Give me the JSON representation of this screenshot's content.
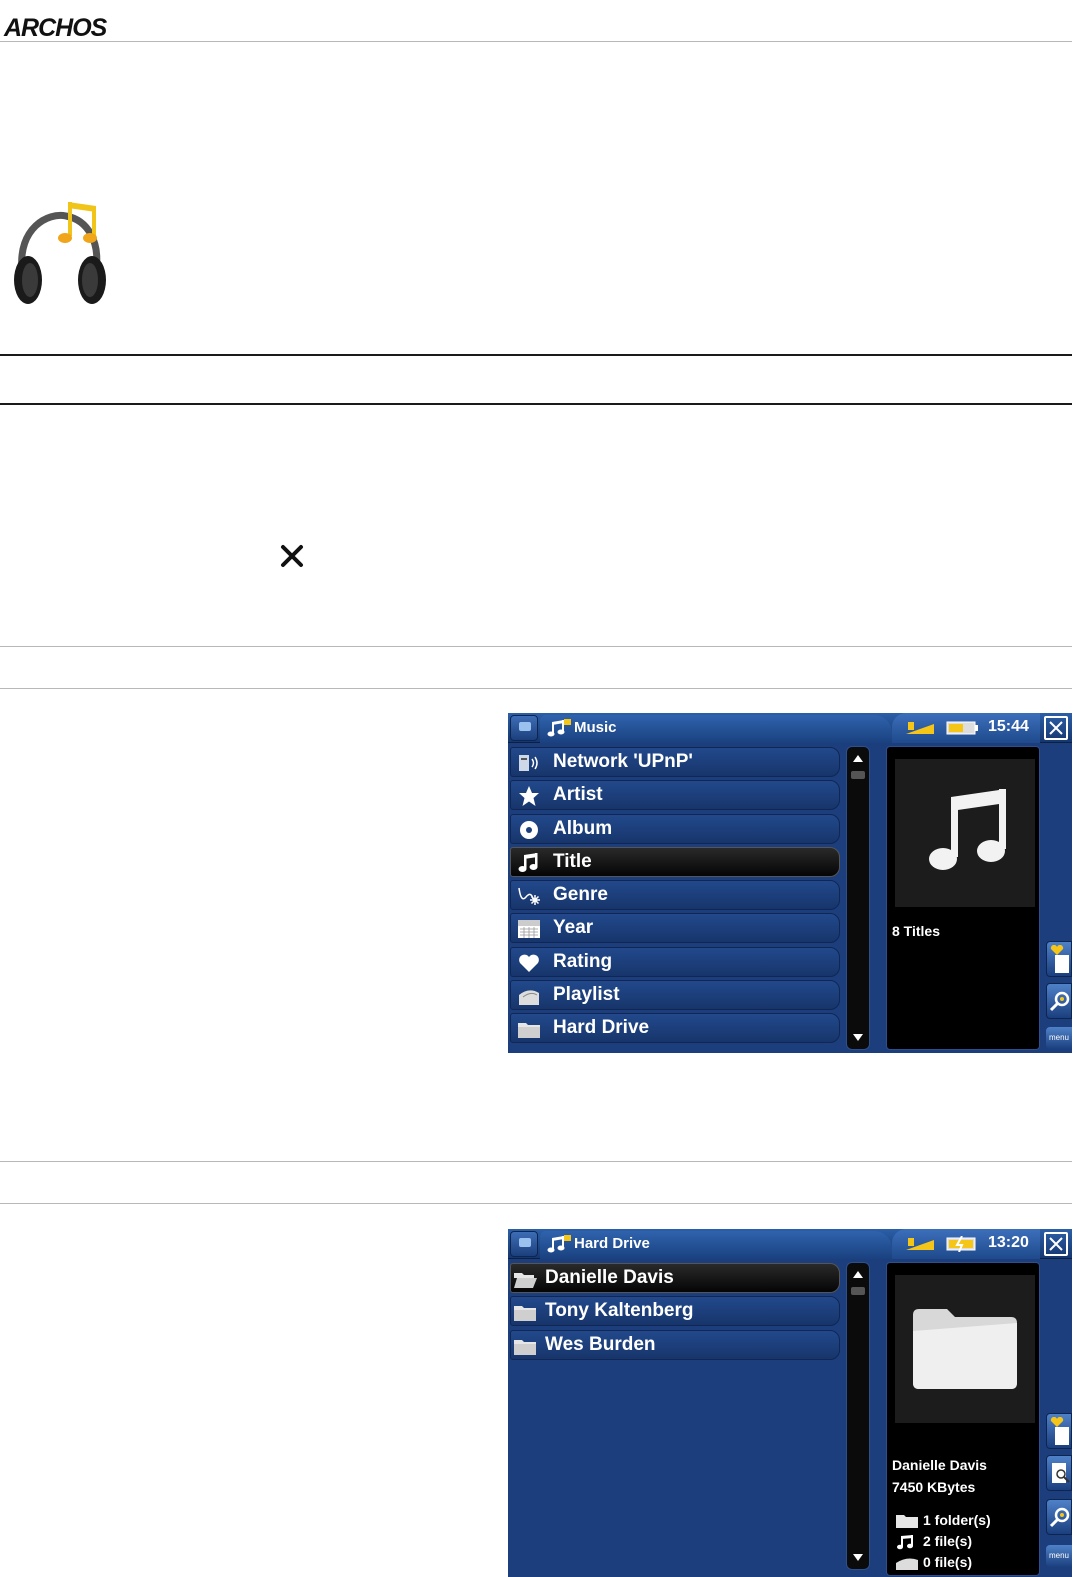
{
  "header": {
    "logo": "ARCHOS"
  },
  "screen1": {
    "title": "Music",
    "time": "15:44",
    "items": [
      {
        "label": "Network 'UPnP'",
        "icon": "network-icon"
      },
      {
        "label": "Artist",
        "icon": "star-icon"
      },
      {
        "label": "Album",
        "icon": "disc-icon"
      },
      {
        "label": "Title",
        "icon": "music-note-icon",
        "selected": true
      },
      {
        "label": "Genre",
        "icon": "genre-icon"
      },
      {
        "label": "Year",
        "icon": "calendar-icon"
      },
      {
        "label": "Rating",
        "icon": "heart-icon"
      },
      {
        "label": "Playlist",
        "icon": "playlist-icon"
      },
      {
        "label": "Hard Drive",
        "icon": "folder-icon"
      }
    ],
    "preview": {
      "caption": "8 Titles"
    },
    "menu_label": "menu"
  },
  "screen2": {
    "title": "Hard Drive",
    "time": "13:20",
    "items": [
      {
        "label": "Danielle Davis",
        "icon": "open-folder-icon",
        "selected": true
      },
      {
        "label": "Tony Kaltenberg",
        "icon": "folder-icon"
      },
      {
        "label": "Wes Burden",
        "icon": "folder-icon"
      }
    ],
    "preview": {
      "name": "Danielle Davis",
      "size": "7450 KBytes",
      "folders": "1 folder(s)",
      "music_files": "2 file(s)",
      "other_files": "0 file(s)"
    },
    "menu_label": "menu"
  },
  "colors": {
    "screen_bg": "#1d3e7c",
    "selected_row": "#050505",
    "accent": "#f5c518"
  }
}
